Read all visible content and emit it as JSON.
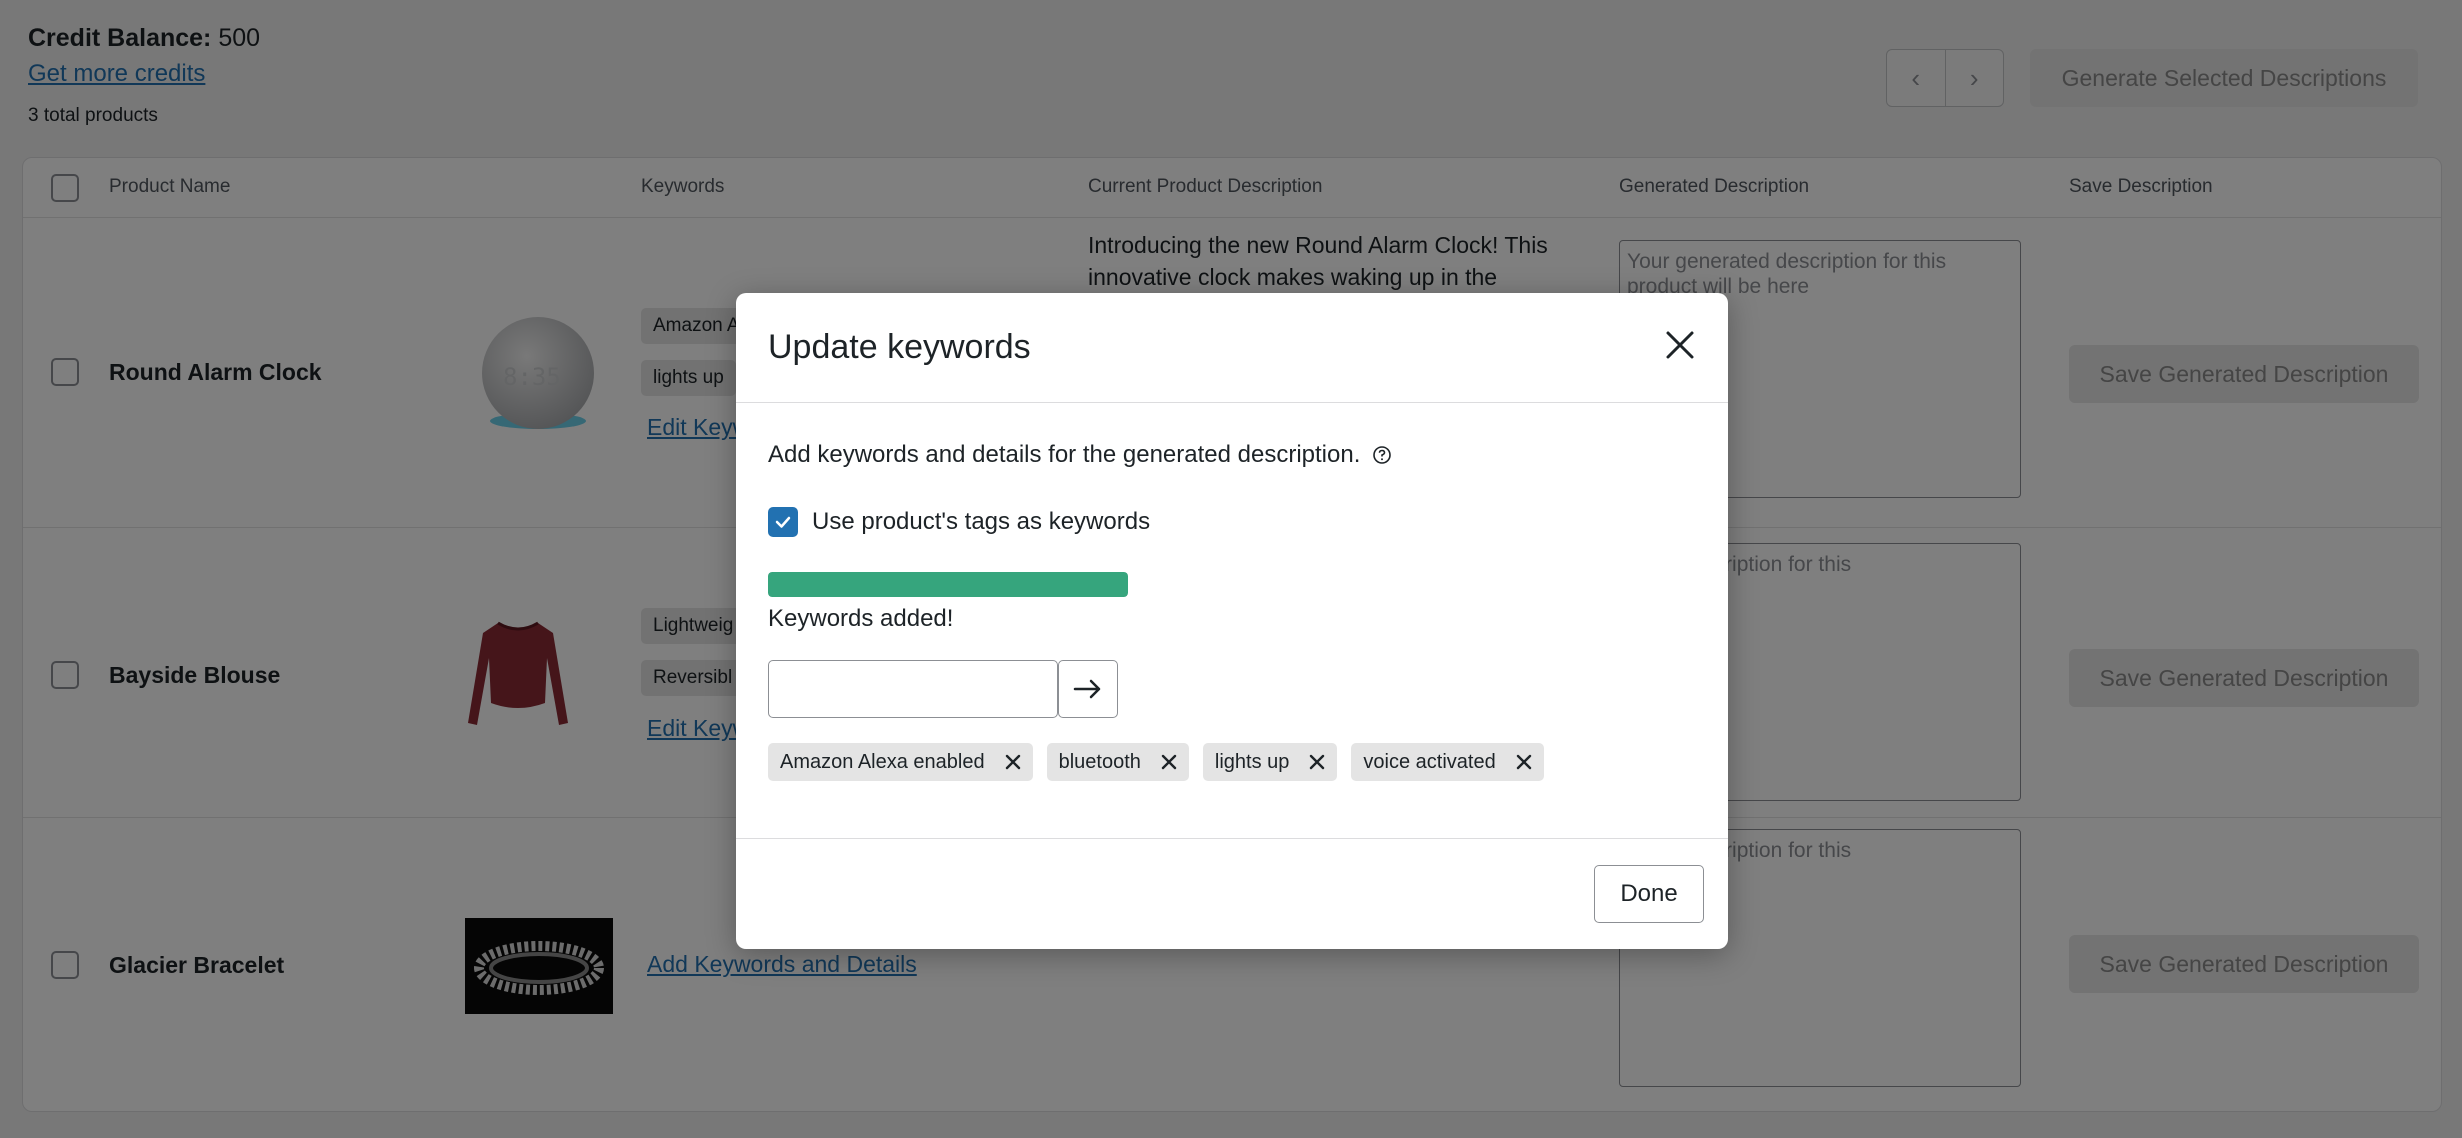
{
  "header": {
    "credit_label": "Credit Balance:",
    "credit_value": "500",
    "get_more_credits": "Get more credits",
    "total_products": "3 total products",
    "prev_icon": "chevron-left-icon",
    "next_icon": "chevron-right-icon",
    "generate_selected": "Generate Selected Descriptions"
  },
  "table": {
    "columns": [
      "Product Name",
      "Keywords",
      "Current Product Description",
      "Generated Description",
      "Save Description"
    ],
    "rows": [
      {
        "name": "Round Alarm Clock",
        "tags": [
          "Amazon A",
          "lights up"
        ],
        "keywords_link": "Edit Keyw",
        "current_description": "Introducing the new Round Alarm Clock! This innovative clock makes waking up in the",
        "generated_placeholder": "Your generated description for this product will be here",
        "save_label": "Save Generated Description"
      },
      {
        "name": "Bayside Blouse",
        "tags": [
          "Lightweig",
          "Reversibl"
        ],
        "keywords_link": "Edit Keyw",
        "current_description": "",
        "generated_placeholder": "rated description for this\nill be here",
        "save_label": "Save Generated Description"
      },
      {
        "name": "Glacier Bracelet",
        "tags": [],
        "keywords_link": "Add Keywords and Details",
        "current_description": "",
        "generated_placeholder": "rated description for this\nill be here",
        "save_label": "Save Generated Description"
      }
    ]
  },
  "modal": {
    "title": "Update keywords",
    "close_icon": "close-icon",
    "description": "Add keywords and details for the generated description.",
    "help_icon": "help-icon",
    "use_tags_label": "Use product's tags as keywords",
    "use_tags_checked": true,
    "progress": 1.0,
    "progress_color": "#36a57d",
    "status": "Keywords added!",
    "input_value": "",
    "submit_icon": "arrow-right-icon",
    "keywords": [
      "Amazon Alexa enabled",
      "bluetooth",
      "lights up",
      "voice activated"
    ],
    "done_label": "Done"
  },
  "colors": {
    "accent": "#2271b1",
    "progress": "#36a57d",
    "overlay": "rgba(0,0,0,0.5)"
  }
}
